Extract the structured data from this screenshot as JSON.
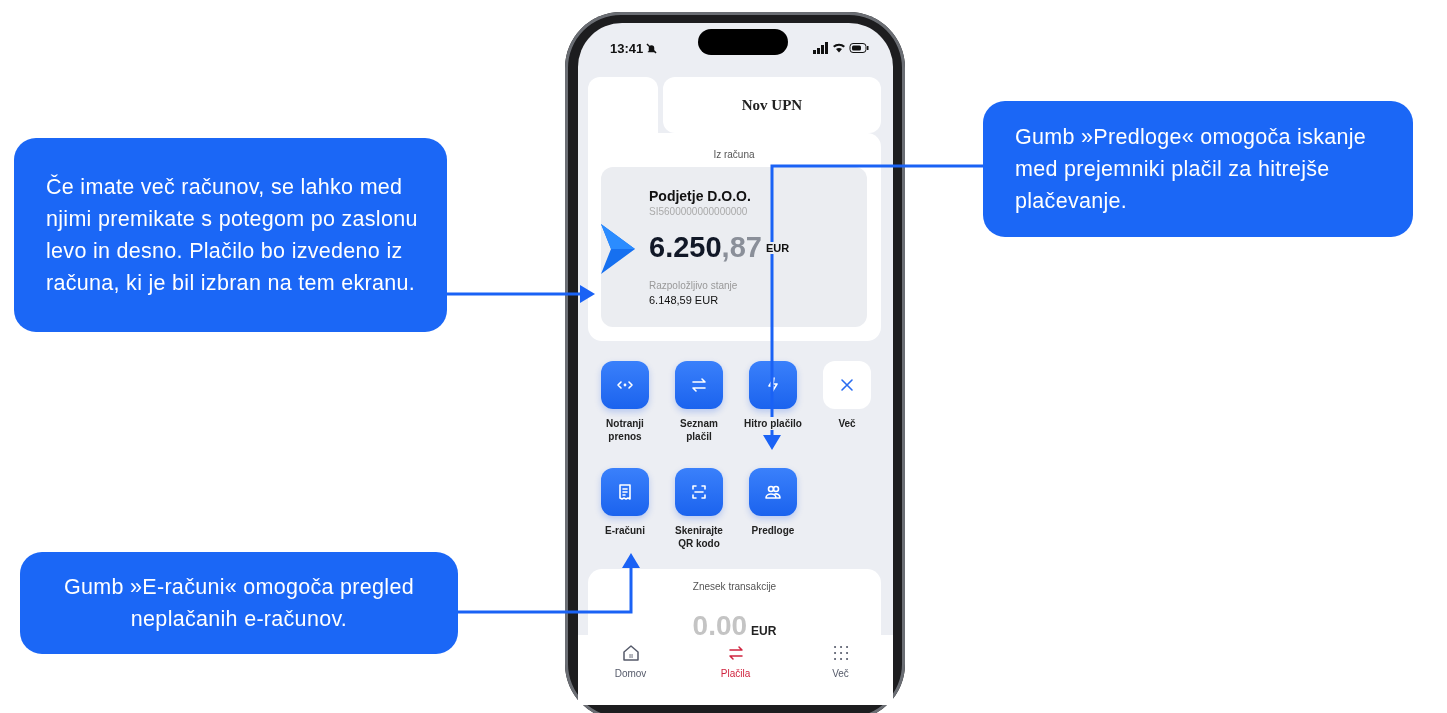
{
  "callouts": [
    {
      "text": "Če imate več računov, se lahko med njimi premikate s potegom po zaslonu levo in desno. Plačilo bo izvedeno iz računa, ki je bil izbran na tem ekranu."
    },
    {
      "text": "Gumb »Predloge« omogoča iskanje med prejemniki plačil za hitrejše plačevanje."
    },
    {
      "text": "Gumb »E-računi« omogoča pregled neplačanih e-računov."
    }
  ],
  "status_bar": {
    "time": "13:41"
  },
  "new_payment_tab": {
    "label": "Nov UPN"
  },
  "account": {
    "heading": "Iz računa",
    "name": "Podjetje D.O.O.",
    "iban": "SI5600000000000000",
    "amount_whole": "6.250",
    "amount_decimal": ",87",
    "currency": "EUR",
    "available_label": "Razpoložljivo stanje",
    "available": "6.148,59 EUR"
  },
  "actions": [
    {
      "label": "Notranji prenos",
      "kind": "primary"
    },
    {
      "label": "Seznam plačil",
      "kind": "primary"
    },
    {
      "label": "Hitro plačilo",
      "kind": "primary"
    },
    {
      "label": "Več",
      "kind": "plain"
    },
    {
      "label": "E-računi",
      "kind": "primary"
    },
    {
      "label": "Skenirajte QR kodo",
      "kind": "primary"
    },
    {
      "label": "Predloge",
      "kind": "primary"
    }
  ],
  "transaction": {
    "label": "Znesek transakcije",
    "amount": "0.00",
    "currency": "EUR"
  },
  "bottom_nav": [
    {
      "label": "Domov",
      "selected": false
    },
    {
      "label": "Plačila",
      "selected": true
    },
    {
      "label": "Več",
      "selected": false
    }
  ]
}
